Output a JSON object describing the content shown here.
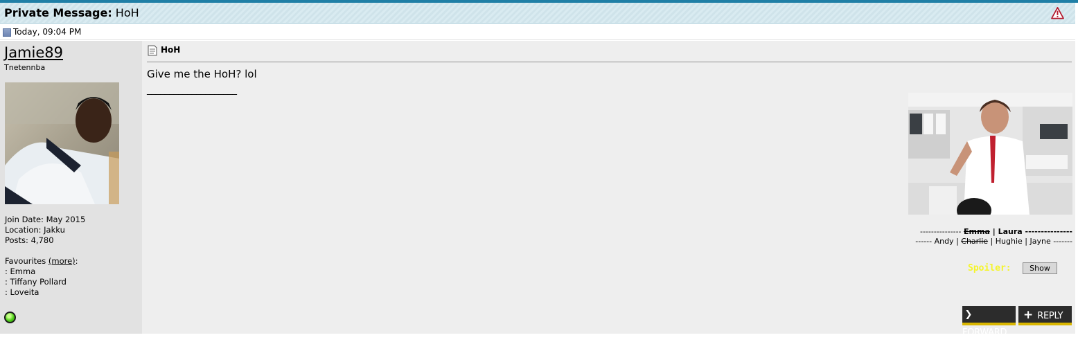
{
  "header": {
    "title_bold": "Private Message:",
    "title_rest": " HoH"
  },
  "meta": {
    "date": "Today, 09:04 PM"
  },
  "user": {
    "name": "Jamie89",
    "usertitle": "Tnetennba",
    "join_date": "Join Date: May 2015",
    "location": "Location: Jakku",
    "posts": "Posts: 4,780",
    "favourites_label": "Favourites ",
    "favourites_more": "(more)",
    "favourites_colon": ":",
    "favourites": [
      ": Emma",
      ": Tiffany Pollard",
      ": Loveita"
    ],
    "status_icon": "online-status-icon"
  },
  "post": {
    "title": "HoH",
    "message": "Give me the HoH? lol",
    "signature_divider": "____________________",
    "signature": {
      "line1_prefix": "--------------- ",
      "line1_strike": "Emma",
      "line1_suffix": " | Laura ---------------",
      "line2_prefix": "------ Andy | ",
      "line2_strike": "Charlie",
      "line2_suffix": " | Hughie | Jayne -------",
      "spoiler_label": "Spoiler:",
      "show_button": "Show"
    }
  },
  "actions": {
    "forward": "FORWARD",
    "reply": "REPLY"
  },
  "colors": {
    "accent": "#1f7fa6",
    "button_bg": "#2c2c2c",
    "button_underline": "#d9b600",
    "spoiler": "#f5f52a"
  }
}
